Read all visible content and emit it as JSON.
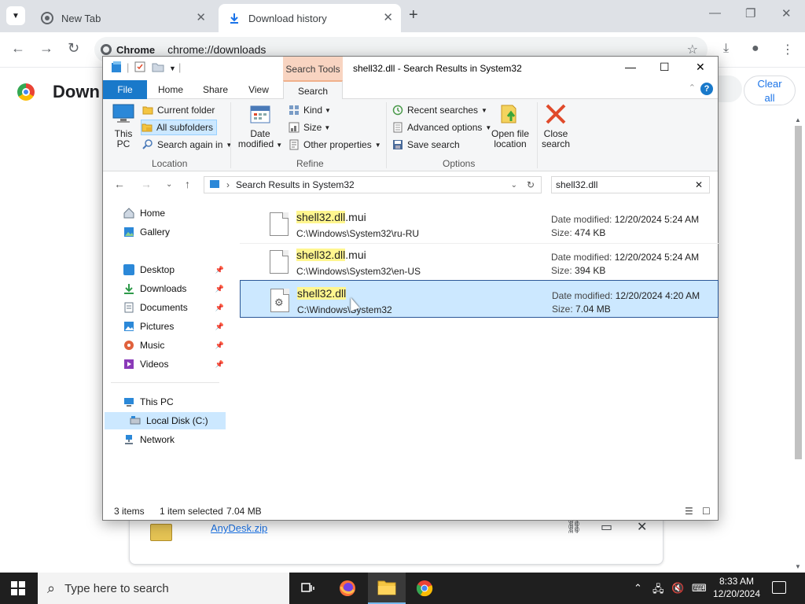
{
  "chrome": {
    "tabs": [
      {
        "label": "New Tab"
      },
      {
        "label": "Download history"
      }
    ],
    "omnibox": {
      "chip": "Chrome",
      "url": "chrome://downloads"
    },
    "page_title": "Down",
    "clear_all_line1": "Clear",
    "clear_all_line2": "all",
    "download_item": {
      "name": "AnyDesk.zip"
    }
  },
  "explorer": {
    "title": "shell32.dll - Search Results in System32",
    "context_tab": "Search Tools",
    "ribbon_tabs": [
      "File",
      "Home",
      "Share",
      "View",
      "Search"
    ],
    "ribbon": {
      "location": {
        "this_pc_line1": "This",
        "this_pc_line2": "PC",
        "current_folder": "Current folder",
        "all_subfolders": "All subfolders",
        "search_again_in": "Search again in",
        "label": "Location"
      },
      "refine": {
        "date_modified_line1": "Date",
        "date_modified_line2": "modified",
        "kind": "Kind",
        "size": "Size",
        "other_properties": "Other properties",
        "label": "Refine"
      },
      "options": {
        "recent_searches": "Recent searches",
        "advanced_options": "Advanced options",
        "save_search": "Save search",
        "open_file_location_line1": "Open file",
        "open_file_location_line2": "location",
        "close_search_line1": "Close",
        "close_search_line2": "search",
        "label": "Options"
      }
    },
    "address": "Search Results in System32",
    "search_query": "shell32.dll",
    "nav_pane": {
      "quick": [
        {
          "label": "Home"
        },
        {
          "label": "Gallery"
        }
      ],
      "pinned": [
        {
          "label": "Desktop"
        },
        {
          "label": "Downloads"
        },
        {
          "label": "Documents"
        },
        {
          "label": "Pictures"
        },
        {
          "label": "Music"
        },
        {
          "label": "Videos"
        }
      ],
      "this_pc": "This PC",
      "local_disk": "Local Disk (C:)",
      "network": "Network"
    },
    "results": [
      {
        "name_match": "shell32.dll",
        "name_rest": ".mui",
        "path": "C:\\Windows\\System32\\ru-RU",
        "date_label": "Date modified:",
        "date": "12/20/2024 5:24 AM",
        "size_label": "Size:",
        "size": "474 KB"
      },
      {
        "name_match": "shell32.dll",
        "name_rest": ".mui",
        "path": "C:\\Windows\\System32\\en-US",
        "date_label": "Date modified:",
        "date": "12/20/2024 5:24 AM",
        "size_label": "Size:",
        "size": "394 KB"
      },
      {
        "name_match": "shell32.dll",
        "name_rest": "",
        "path": "C:\\Windows\\System32",
        "date_label": "Date modified:",
        "date": "12/20/2024 4:20 AM",
        "size_label": "Size:",
        "size": "7.04 MB"
      }
    ],
    "status": {
      "items": "3 items",
      "selected": "1 item selected",
      "selected_size": "7.04 MB"
    }
  },
  "taskbar": {
    "search_placeholder": "Type here to search",
    "time": "8:33 AM",
    "date": "12/20/2024"
  },
  "colors": {
    "accent": "#1979ca",
    "selection": "#cce8ff",
    "highlight": "#fff68f",
    "context_tab": "#f8d4c1"
  }
}
